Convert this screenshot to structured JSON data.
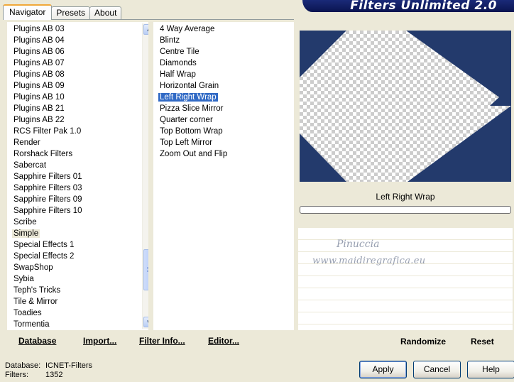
{
  "app": {
    "title": "Filters Unlimited 2.0"
  },
  "tabs": [
    {
      "label": "Navigator"
    },
    {
      "label": "Presets"
    },
    {
      "label": "About"
    }
  ],
  "categories": {
    "items": [
      "Plugins AB 03",
      "Plugins AB 04",
      "Plugins AB 06",
      "Plugins AB 07",
      "Plugins AB 08",
      "Plugins AB 09",
      "Plugins AB 10",
      "Plugins AB 21",
      "Plugins AB 22",
      "RCS Filter Pak 1.0",
      "Render",
      "Rorshack Filters",
      "Sabercat",
      "Sapphire Filters 01",
      "Sapphire Filters 03",
      "Sapphire Filters 09",
      "Sapphire Filters 10",
      "Scribe",
      "Simple",
      "Special Effects 1",
      "Special Effects 2",
      "SwapShop",
      "Sybia",
      "Teph's Tricks",
      "Tile & Mirror",
      "Toadies",
      "Tormentia"
    ],
    "selected": "Simple"
  },
  "filters": {
    "items": [
      "4 Way Average",
      "Blintz",
      "Centre Tile",
      "Diamonds",
      "Half Wrap",
      "Horizontal Grain",
      "Left Right Wrap",
      "Pizza Slice Mirror",
      "Quarter corner",
      "Top Bottom Wrap",
      "Top Left Mirror",
      "Zoom Out and Flip"
    ],
    "selected": "Left Right Wrap"
  },
  "toolbar": {
    "database": "Database",
    "import": "Import...",
    "filter_info": "Filter Info...",
    "editor": "Editor..."
  },
  "preview": {
    "filter_name": "Left Right Wrap",
    "shape_color": "#233a6c"
  },
  "watermark": {
    "line1": "Pinuccia",
    "line2": "www.maidiregrafica.eu"
  },
  "actions": {
    "randomize": "Randomize",
    "reset": "Reset"
  },
  "status": {
    "database_label": "Database:",
    "database_value": "ICNET-Filters",
    "filters_label": "Filters:",
    "filters_value": "1352"
  },
  "buttons": {
    "apply": "Apply",
    "cancel": "Cancel",
    "help": "Help"
  }
}
